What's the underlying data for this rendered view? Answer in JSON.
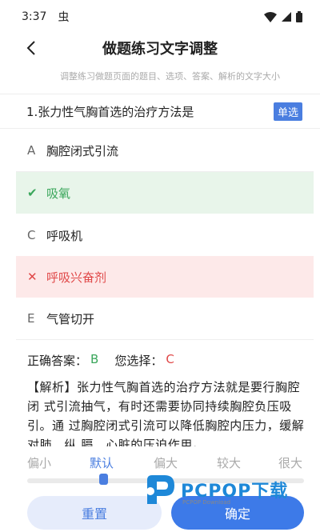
{
  "status": {
    "time": "3:37",
    "app_icon": "虫"
  },
  "header": {
    "title": "做题练习文字调整"
  },
  "subtitle": "调整练习做题页面的题目、选项、答案、解析的文字大小",
  "question": {
    "text": "1.张力性气胸首选的治疗方法是",
    "type_badge": "单选"
  },
  "options": [
    {
      "letter": "A",
      "text": "胸腔闭式引流",
      "state": "normal"
    },
    {
      "letter": "✔",
      "text": "吸氧",
      "state": "correct"
    },
    {
      "letter": "C",
      "text": "呼吸机",
      "state": "normal"
    },
    {
      "letter": "✕",
      "text": "呼吸兴奋剂",
      "state": "wrong"
    },
    {
      "letter": "E",
      "text": "气管切开",
      "state": "normal"
    }
  ],
  "answer": {
    "correct_label": "正确答案：",
    "correct_value": "B",
    "choice_label": "您选择：",
    "choice_value": "C"
  },
  "analysis": "【解析】张力性气胸首选的治疗方法就是要行胸腔闭 式引流抽气，有时还需要协同持续胸腔负压吸引。通 过胸腔闭式引流可以降低胸腔内压力，缓解对肺、纵 膈、心脏的压迫作用。",
  "size_options": [
    "偏小",
    "默认",
    "偏大",
    "较大",
    "很大"
  ],
  "selected_size": "默认",
  "buttons": {
    "reset": "重置",
    "confirm": "确定"
  },
  "watermark": {
    "text": "PCPOP下载",
    "sub": "PCPOP Download"
  },
  "colors": {
    "accent": "#4a7ee0",
    "correct": "#3aa65b",
    "wrong": "#e04848"
  }
}
